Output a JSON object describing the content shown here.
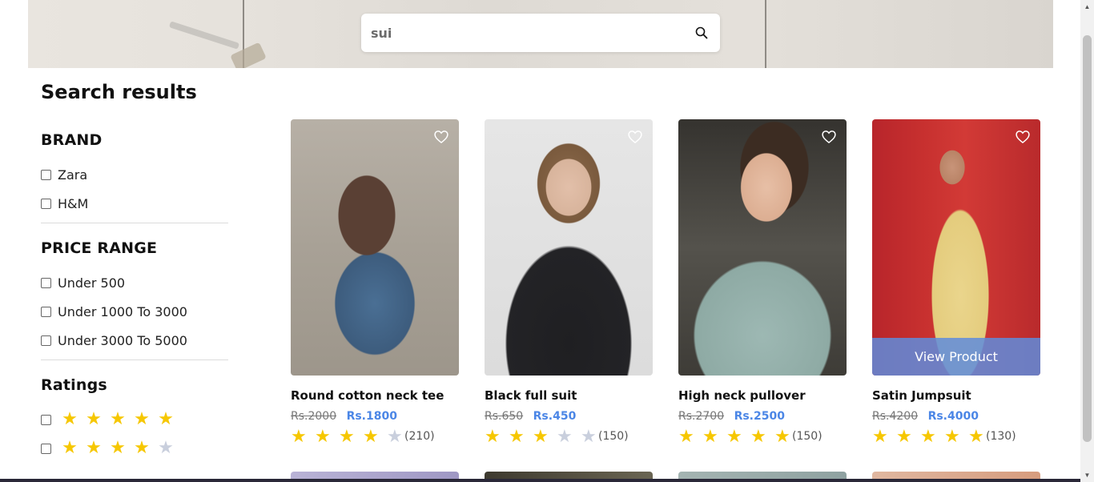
{
  "search": {
    "value": "sui"
  },
  "results_title": "Search results",
  "filters": {
    "brand": {
      "title": "BRAND",
      "options": [
        "Zara",
        "H&M"
      ]
    },
    "price": {
      "title": "PRICE RANGE",
      "options": [
        "Under 500",
        "Under 1000 To 3000",
        "Under 3000 To 5000"
      ]
    },
    "ratings": {
      "title": "Ratings",
      "rows": [
        5,
        4
      ]
    }
  },
  "products": [
    {
      "name": "Round cotton neck tee",
      "old_price": "Rs.2000",
      "price": "Rs.1800",
      "rating": 4,
      "count": "(210)"
    },
    {
      "name": "Black full suit",
      "old_price": "Rs.650",
      "price": "Rs.450",
      "rating": 3,
      "count": "(150)"
    },
    {
      "name": "High neck pullover",
      "old_price": "Rs.2700",
      "price": "Rs.2500",
      "rating": 5,
      "count": "(150)"
    },
    {
      "name": "Satin Jumpsuit",
      "old_price": "Rs.4200",
      "price": "Rs.4000",
      "rating": 5,
      "count": "(130)",
      "view_label": "View Product"
    }
  ],
  "colors": {
    "accent": "#4b86e6",
    "star": "#f6c700",
    "star_off": "#c9cfdd"
  }
}
